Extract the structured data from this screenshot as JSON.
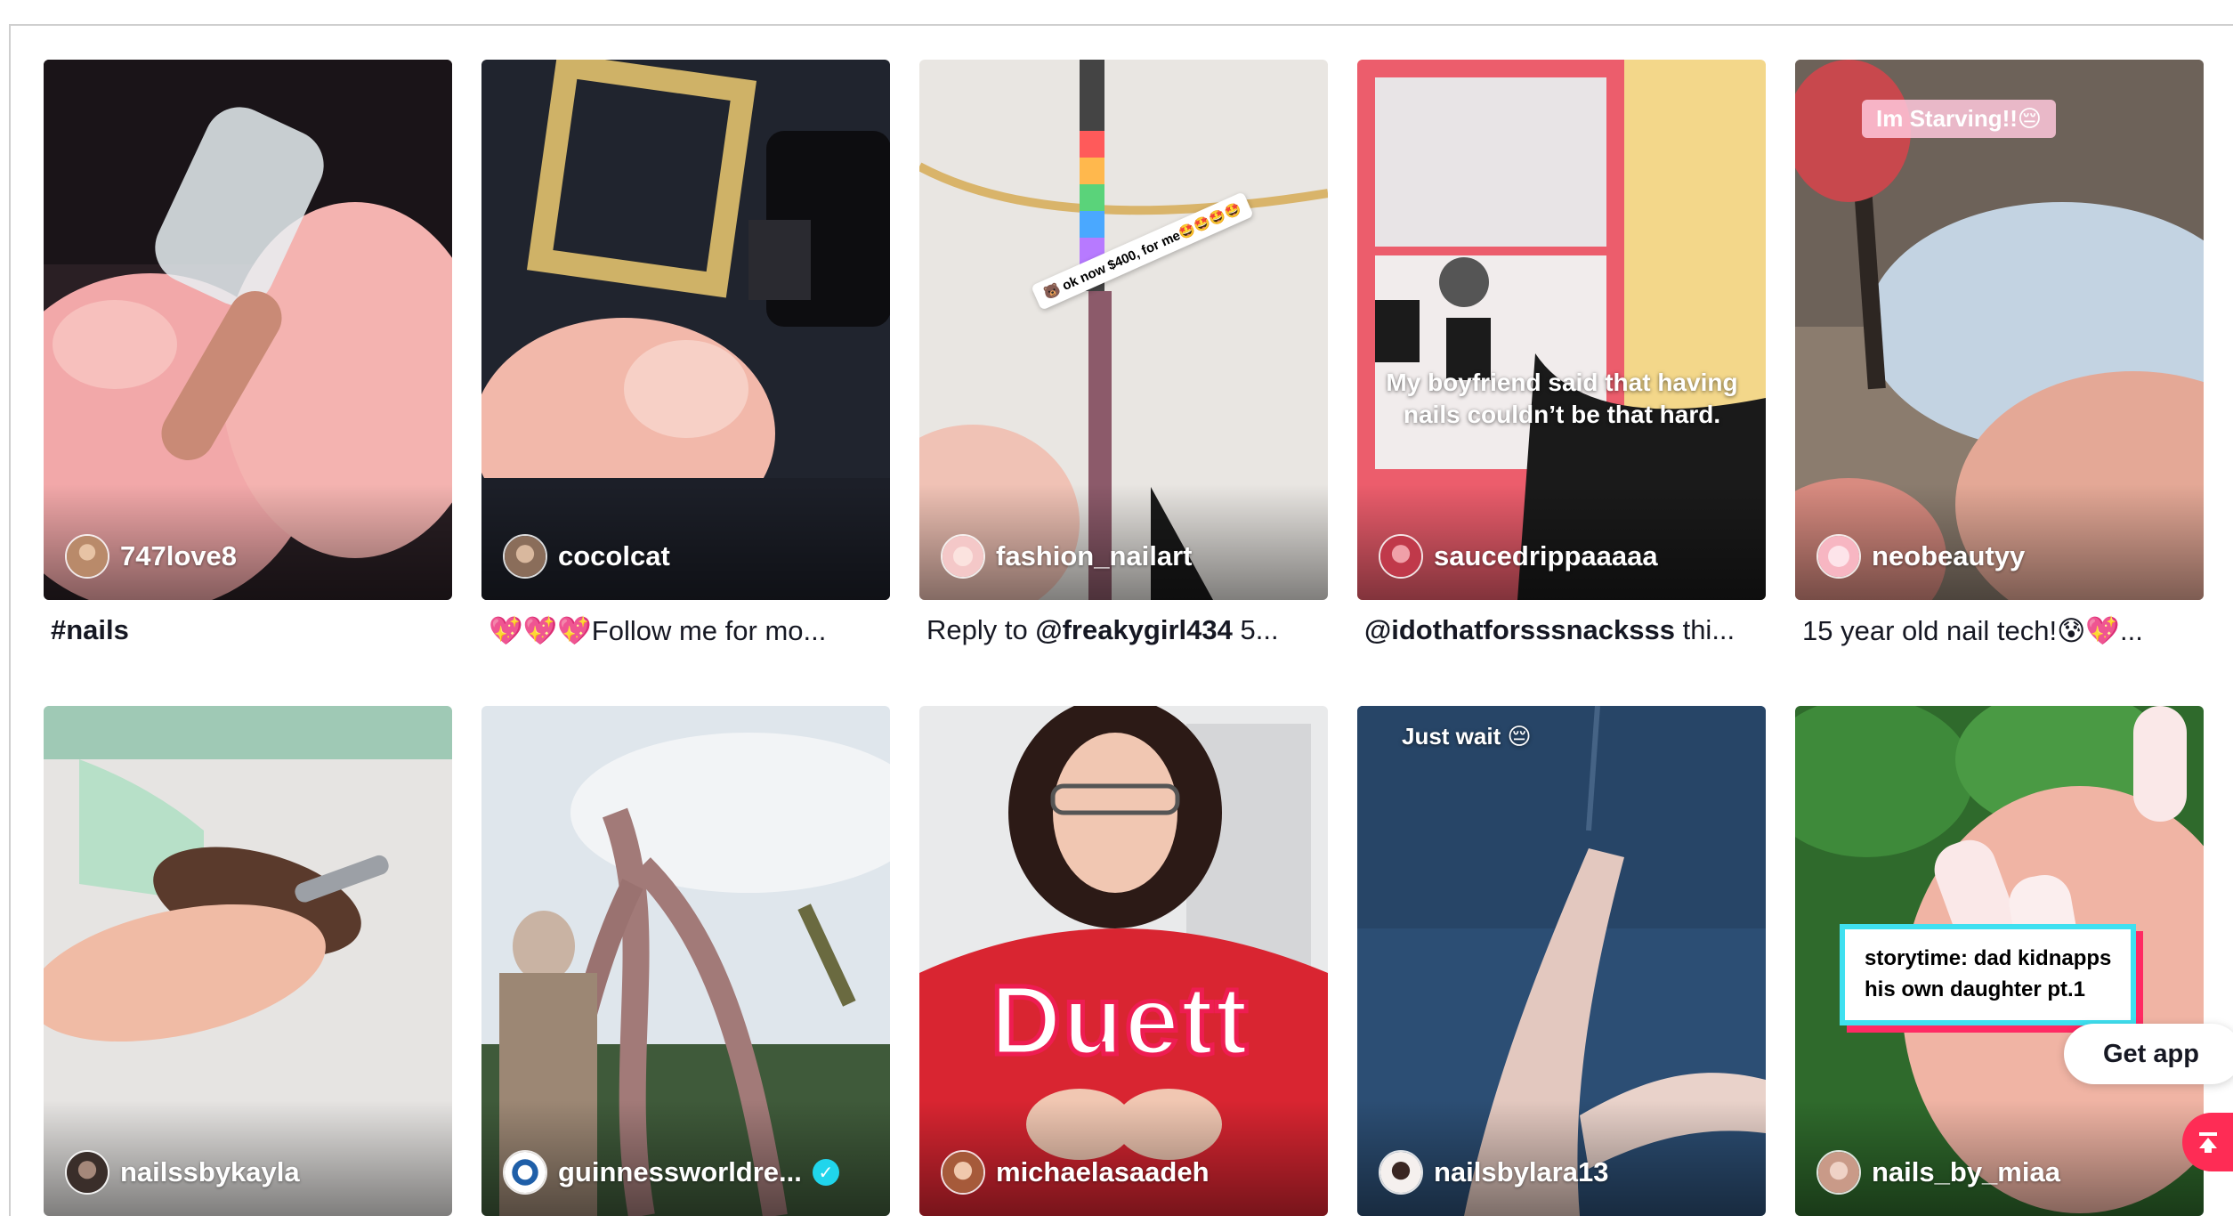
{
  "grid": {
    "row1": [
      {
        "author": "747love8",
        "caption": "#nails",
        "caption_bold": true
      },
      {
        "author": "cocolcat",
        "caption_emoji": "💖💖💖",
        "caption": "Follow me for mo..."
      },
      {
        "author": "fashion_nailart",
        "caption_prefix": "Reply to ",
        "caption_mention": "@freakygirl434",
        "caption_suffix": " 5...",
        "sticker_text": "🐻 ok now $400, for me🤩🤩🤩🤩"
      },
      {
        "author": "saucedrippaaaaa",
        "caption_mention": "@idothatforsssnacksss",
        "caption_suffix": " thi...",
        "overlay_text": "My boyfriend said that having nails couldn’t be that hard."
      },
      {
        "author": "neobeautyy",
        "caption": "15 year old nail tech!😰💖...",
        "overlay_label": "Im Starving!!😔"
      }
    ],
    "row2": [
      {
        "author": "nailssbykayla"
      },
      {
        "author": "guinnessworldre...",
        "verified": true
      },
      {
        "author": "michaelasaadeh",
        "overlay_text": "Duett"
      },
      {
        "author": "nailsbylara13",
        "overlay_text": "Just wait 😔"
      },
      {
        "author": "nails_by_miaa",
        "story_line1": "storytime: dad kidnapps",
        "story_line2": "his own daughter pt.1"
      }
    ]
  },
  "buttons": {
    "get_app": "Get app",
    "back_to_top_icon": "arrow-up-to-top-icon"
  },
  "colors": {
    "accent": "#fe2c55",
    "verified": "#20d5ec",
    "text": "#161823"
  }
}
